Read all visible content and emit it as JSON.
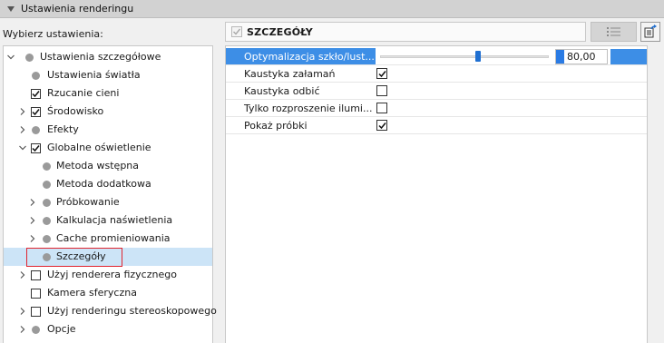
{
  "panel": {
    "title": "Ustawienia renderingu"
  },
  "left": {
    "label": "Wybierz ustawienia:",
    "tree": [
      {
        "label": "Ustawienia szczegółowe",
        "expander": "expanded",
        "marker": "dot",
        "level": 0
      },
      {
        "label": "Ustawienia światła",
        "expander": "none",
        "marker": "dot",
        "level": 1
      },
      {
        "label": "Rzucanie cieni",
        "expander": "none",
        "marker": "checkbox",
        "checked": true,
        "level": 1
      },
      {
        "label": "Środowisko",
        "expander": "collapsed",
        "marker": "checkbox",
        "checked": true,
        "level": 1
      },
      {
        "label": "Efekty",
        "expander": "collapsed",
        "marker": "dot",
        "level": 1
      },
      {
        "label": "Globalne oświetlenie",
        "expander": "expanded",
        "marker": "checkbox",
        "checked": true,
        "level": 1
      },
      {
        "label": "Metoda wstępna",
        "expander": "none",
        "marker": "dot",
        "level": 2
      },
      {
        "label": "Metoda dodatkowa",
        "expander": "none",
        "marker": "dot",
        "level": 2
      },
      {
        "label": "Próbkowanie",
        "expander": "collapsed",
        "marker": "dot",
        "level": 2
      },
      {
        "label": "Kalkulacja naświetlenia",
        "expander": "collapsed",
        "marker": "dot",
        "level": 2
      },
      {
        "label": "Cache promieniowania",
        "expander": "collapsed",
        "marker": "dot",
        "level": 2
      },
      {
        "label": "Szczegóły",
        "expander": "none",
        "marker": "dot",
        "level": 2,
        "selected": true
      },
      {
        "label": "Użyj renderera fizycznego",
        "expander": "collapsed",
        "marker": "checkbox",
        "checked": false,
        "level": 1
      },
      {
        "label": "Kamera sferyczna",
        "expander": "none",
        "marker": "checkbox",
        "checked": false,
        "level": 1
      },
      {
        "label": "Użyj renderingu stereoskopowego",
        "expander": "collapsed",
        "marker": "checkbox",
        "checked": false,
        "level": 1
      },
      {
        "label": "Opcje",
        "expander": "collapsed",
        "marker": "dot",
        "level": 1
      }
    ]
  },
  "right": {
    "header": {
      "title": "SZCZEGÓŁY",
      "checked": true
    },
    "buttons": {
      "list_icon": "list-icon",
      "export_icon": "export-icon"
    },
    "properties": [
      {
        "label": "Optymalizacja szkło/lust...",
        "type": "slider",
        "value": "80,00",
        "slider_fraction": 0.58,
        "highlighted": true
      },
      {
        "label": "Kaustyka załamań",
        "type": "checkbox",
        "checked": true
      },
      {
        "label": "Kaustyka odbić",
        "type": "checkbox",
        "checked": false
      },
      {
        "label": "Tylko rozproszenie ilumi...",
        "type": "checkbox",
        "checked": false
      },
      {
        "label": "Pokaż próbki",
        "type": "checkbox",
        "checked": true
      }
    ]
  },
  "colors": {
    "selection": "#cce4f7",
    "highlight": "#3d8ee6",
    "accent": "#1f6fd1",
    "outline": "#e0242f"
  }
}
